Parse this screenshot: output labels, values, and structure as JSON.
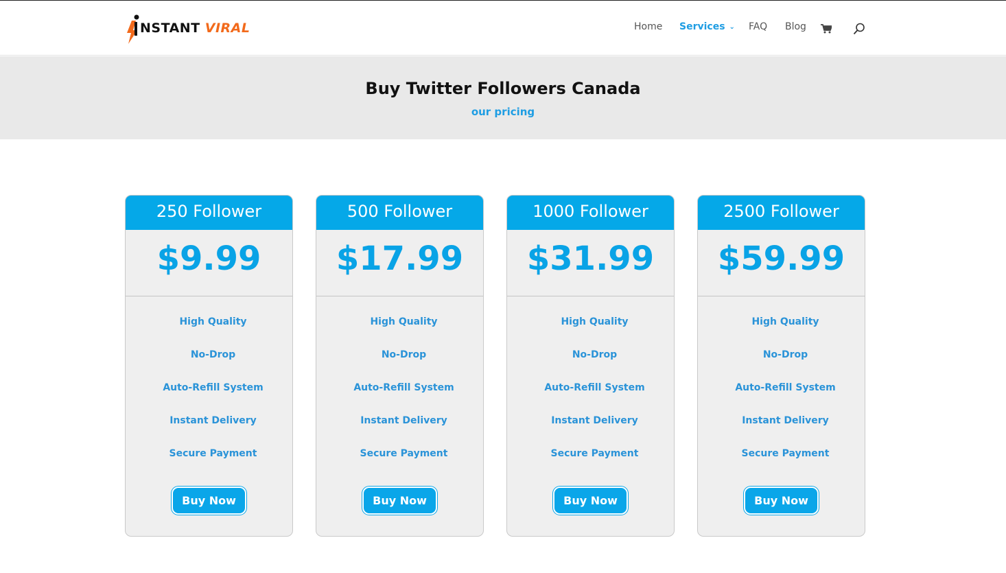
{
  "brand": {
    "part1": "NSTANT",
    "part2": "VIRAL",
    "accent": "#f26a1b"
  },
  "nav": {
    "items": [
      {
        "label": "Home"
      },
      {
        "label": "Services"
      },
      {
        "label": "FAQ"
      },
      {
        "label": "Blog"
      }
    ],
    "cart_icon": "shopping-cart-icon",
    "search_icon": "search-icon"
  },
  "banner": {
    "title": "Buy Twitter Followers Canada",
    "subtitle": "our pricing"
  },
  "colors": {
    "primary": "#05a8e8",
    "link": "#1e9de3",
    "banner_bg": "#e9e9e9",
    "card_bg": "#efefef"
  },
  "plans": [
    {
      "name": "250 Follower",
      "price": "$9.99",
      "features": [
        "High Quality",
        "No-Drop",
        "Auto-Refill System",
        "Instant Delivery",
        "Secure Payment"
      ],
      "button": "Buy Now"
    },
    {
      "name": "500 Follower",
      "price": "$17.99",
      "features": [
        "High Quality",
        "No-Drop",
        "Auto-Refill System",
        "Instant Delivery",
        "Secure Payment"
      ],
      "button": "Buy Now"
    },
    {
      "name": "1000 Follower",
      "price": "$31.99",
      "features": [
        "High Quality",
        "No-Drop",
        "Auto-Refill System",
        "Instant Delivery",
        "Secure Payment"
      ],
      "button": "Buy Now"
    },
    {
      "name": "2500 Follower",
      "price": "$59.99",
      "features": [
        "High Quality",
        "No-Drop",
        "Auto-Refill System",
        "Instant Delivery",
        "Secure Payment"
      ],
      "button": "Buy Now"
    }
  ]
}
